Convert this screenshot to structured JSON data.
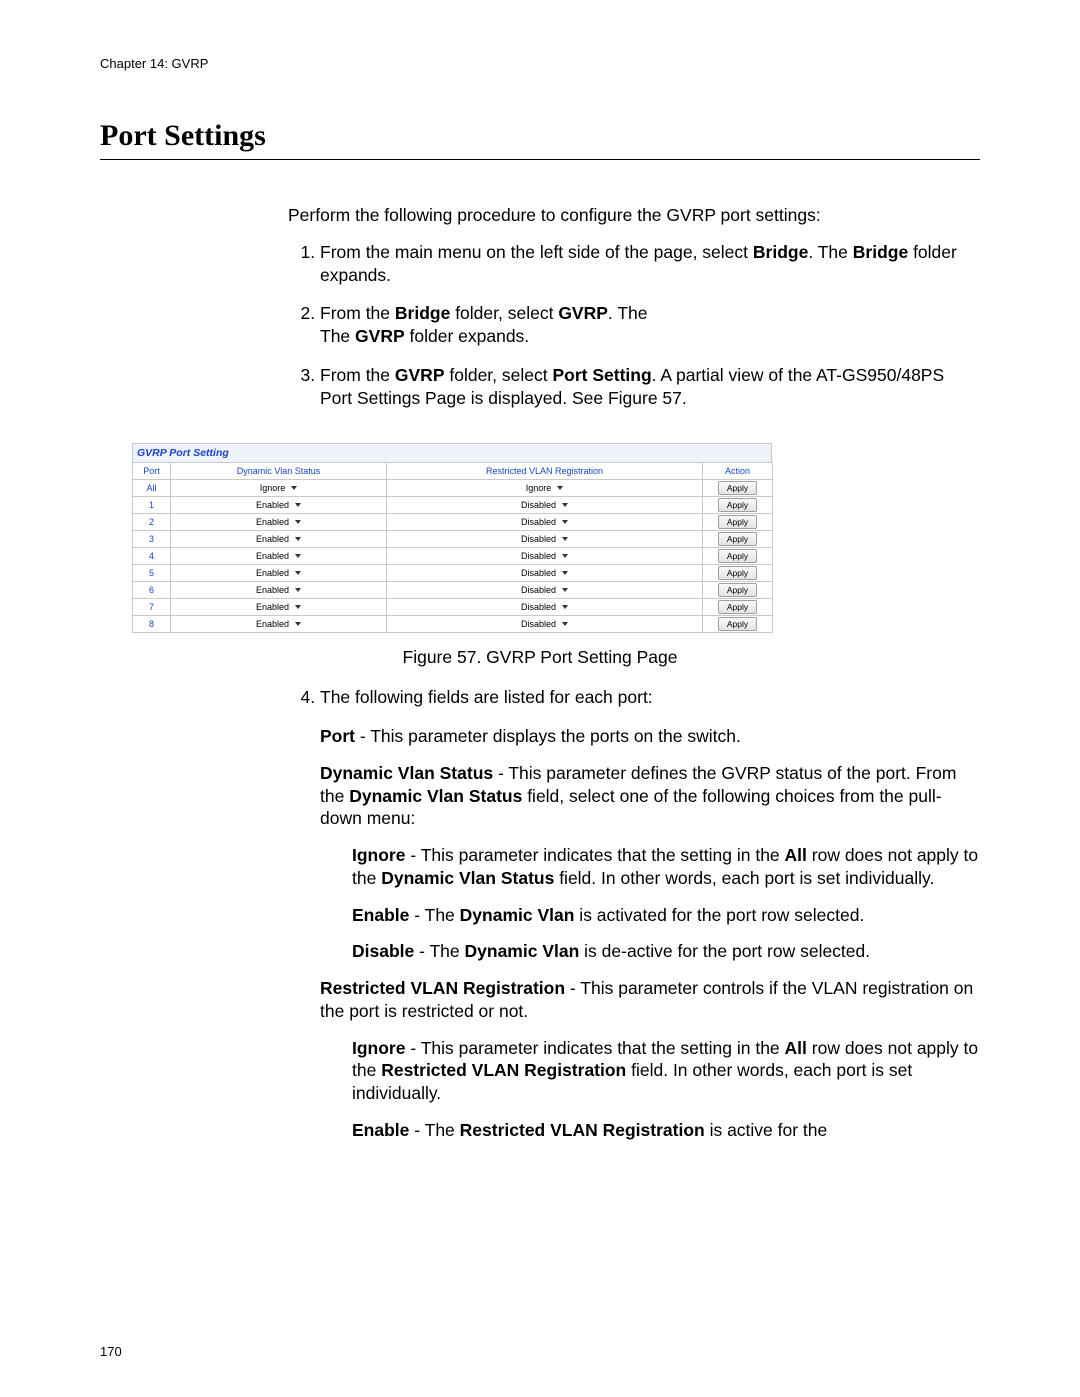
{
  "chapter_header": "Chapter 14: GVRP",
  "title": "Port Settings",
  "intro": "Perform the following procedure to configure the GVRP port settings:",
  "steps": {
    "s1a": "From the main menu on the left side of the page, select ",
    "s1b": "Bridge",
    "s1c": ". The ",
    "s1d": "Bridge",
    "s1e": " folder expands.",
    "s2a": "From the ",
    "s2b": "Bridge",
    "s2c": " folder, select ",
    "s2d": "GVRP",
    "s2e": ". The ",
    "s2f": "GVRP",
    "s2g": " folder expands.",
    "s3a": "From the ",
    "s3b": "GVRP",
    "s3c": " folder, select ",
    "s3d": "Port Setting",
    "s3e": ". A partial view of the AT-GS950/48PS Port Settings Page is displayed. See Figure 57.",
    "s4": "The following fields are listed for each port:"
  },
  "screenshot": {
    "title": "GVRP Port Setting",
    "headers": {
      "port": "Port",
      "dvs": "Dynamic Vlan Status",
      "rvr": "Restricted VLAN Registration",
      "action": "Action"
    },
    "apply_label": "Apply",
    "rows": [
      {
        "port": "All",
        "dvs": "Ignore",
        "rvr": "Ignore"
      },
      {
        "port": "1",
        "dvs": "Enabled",
        "rvr": "Disabled"
      },
      {
        "port": "2",
        "dvs": "Enabled",
        "rvr": "Disabled"
      },
      {
        "port": "3",
        "dvs": "Enabled",
        "rvr": "Disabled"
      },
      {
        "port": "4",
        "dvs": "Enabled",
        "rvr": "Disabled"
      },
      {
        "port": "5",
        "dvs": "Enabled",
        "rvr": "Disabled"
      },
      {
        "port": "6",
        "dvs": "Enabled",
        "rvr": "Disabled"
      },
      {
        "port": "7",
        "dvs": "Enabled",
        "rvr": "Disabled"
      },
      {
        "port": "8",
        "dvs": "Enabled",
        "rvr": "Disabled"
      }
    ]
  },
  "figure_caption": "Figure 57. GVRP Port Setting Page",
  "fields": {
    "port_label": "Port",
    "port_text": " - This parameter displays the ports on the switch.",
    "dvs_label": "Dynamic Vlan Status",
    "dvs_text_a": " - This parameter defines the GVRP status of the port. From the ",
    "dvs_text_b": "Dynamic Vlan Status",
    "dvs_text_c": " field, select one of the following choices from the pull-down menu:",
    "ignore_label": "Ignore",
    "dvs_ignore_a": " - This parameter indicates that the setting in the ",
    "all_label": "All",
    "dvs_ignore_b": " row does not apply to the ",
    "dvs_ignore_c": "Dynamic Vlan Status",
    "dvs_ignore_d": " field. In other words, each port is set individually.",
    "enable_label": "Enable",
    "dvs_enable_a": " - The ",
    "dvs_enable_b": "Dynamic Vlan",
    "dvs_enable_c": " is activated for the port row selected.",
    "disable_label": "Disable",
    "dvs_disable_a": " - The ",
    "dvs_disable_b": "Dynamic Vlan",
    "dvs_disable_c": " is de-active for the port row selected.",
    "rvr_label": "Restricted VLAN Registration",
    "rvr_text": " - This parameter controls if the VLAN registration on the port is restricted or not.",
    "rvr_ignore_a": " - This parameter indicates that the setting in the ",
    "rvr_ignore_b": " row does not apply to the ",
    "rvr_ignore_c": "Restricted VLAN Registration",
    "rvr_ignore_d": " field. In other words, each port is set individually.",
    "rvr_enable_a": " - The ",
    "rvr_enable_b": "Restricted VLAN Registration",
    "rvr_enable_c": " is active for the"
  },
  "page_number": "170"
}
